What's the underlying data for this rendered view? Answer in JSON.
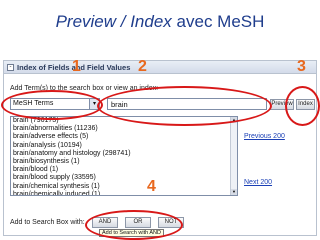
{
  "slide": {
    "title_italic": "Preview / Index",
    "title_rest": " avec MeSH"
  },
  "panel": {
    "title": "Index of Fields and Field Values",
    "collapse_glyph": "-",
    "instruction": "Add Term(s) to the search box or view an index:"
  },
  "search": {
    "field_select": "MeSH Terms",
    "select_arrow": "▾",
    "query": "brain",
    "preview_label": "Preview",
    "index_label": "Index"
  },
  "results": {
    "rows": [
      "brain (796173)",
      "brain/abnormalities (11236)",
      "brain/adverse effects (5)",
      "brain/analysis (10194)",
      "brain/anatomy and histology (298741)",
      "brain/biosynthesis (1)",
      "brain/blood (1)",
      "brain/blood supply (33595)",
      "brain/chemical synthesis (1)",
      "brain/chemically induced (1)"
    ],
    "previous_label": "Previous 200",
    "next_label": "Next 200",
    "scroll_up": "▲",
    "scroll_down": "▼"
  },
  "add_box": {
    "label": "Add to Search Box with:",
    "and_label": "AND",
    "or_label": "OR",
    "not_label": "NOT",
    "tooltip": "Add to Search with AND"
  },
  "annotations": {
    "one": "1",
    "two": "2",
    "three": "3",
    "four": "4",
    "number_color": "#e8681e",
    "circle_color": "#d81818"
  }
}
